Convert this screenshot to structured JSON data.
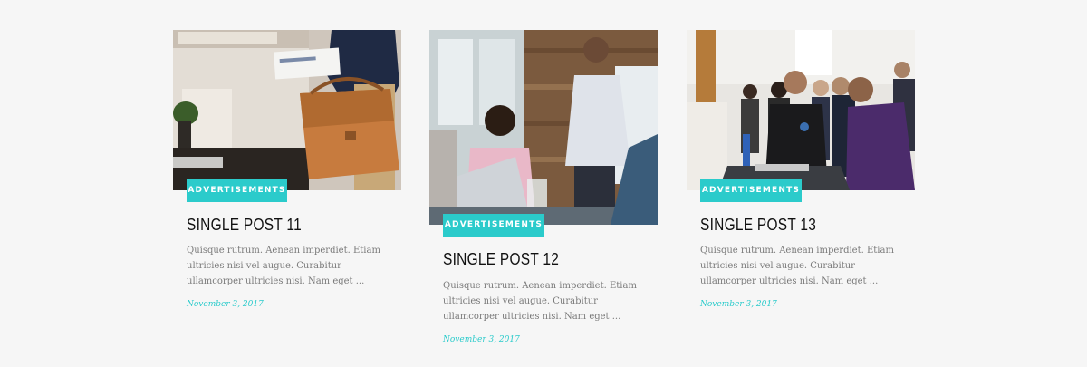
{
  "accent_color": "#2bcbcb",
  "posts": [
    {
      "category": "ADVERTISEMENTS",
      "title": "SINGLE POST 11",
      "excerpt": "Quisque rutrum. Aenean imperdiet. Etiam ultricies nisi vel augue. Curabitur ullamcorper ultricies nisi. Nam eget ...",
      "date": "November 3, 2017",
      "image": "businessman-with-leather-briefcase-photo"
    },
    {
      "category": "ADVERTISEMENTS",
      "title": "SINGLE POST 12",
      "excerpt": "Quisque rutrum. Aenean imperdiet. Etiam ultricies nisi vel augue. Curabitur ullamcorper ultricies nisi. Nam eget ...",
      "date": "November 3, 2017",
      "image": "office-meeting-with-laptop-photo"
    },
    {
      "category": "ADVERTISEMENTS",
      "title": "SINGLE POST 13",
      "excerpt": "Quisque rutrum. Aenean imperdiet. Etiam ultricies nisi vel augue. Curabitur ullamcorper ultricies nisi. Nam eget ...",
      "date": "November 3, 2017",
      "image": "conference-crowd-photo"
    }
  ]
}
